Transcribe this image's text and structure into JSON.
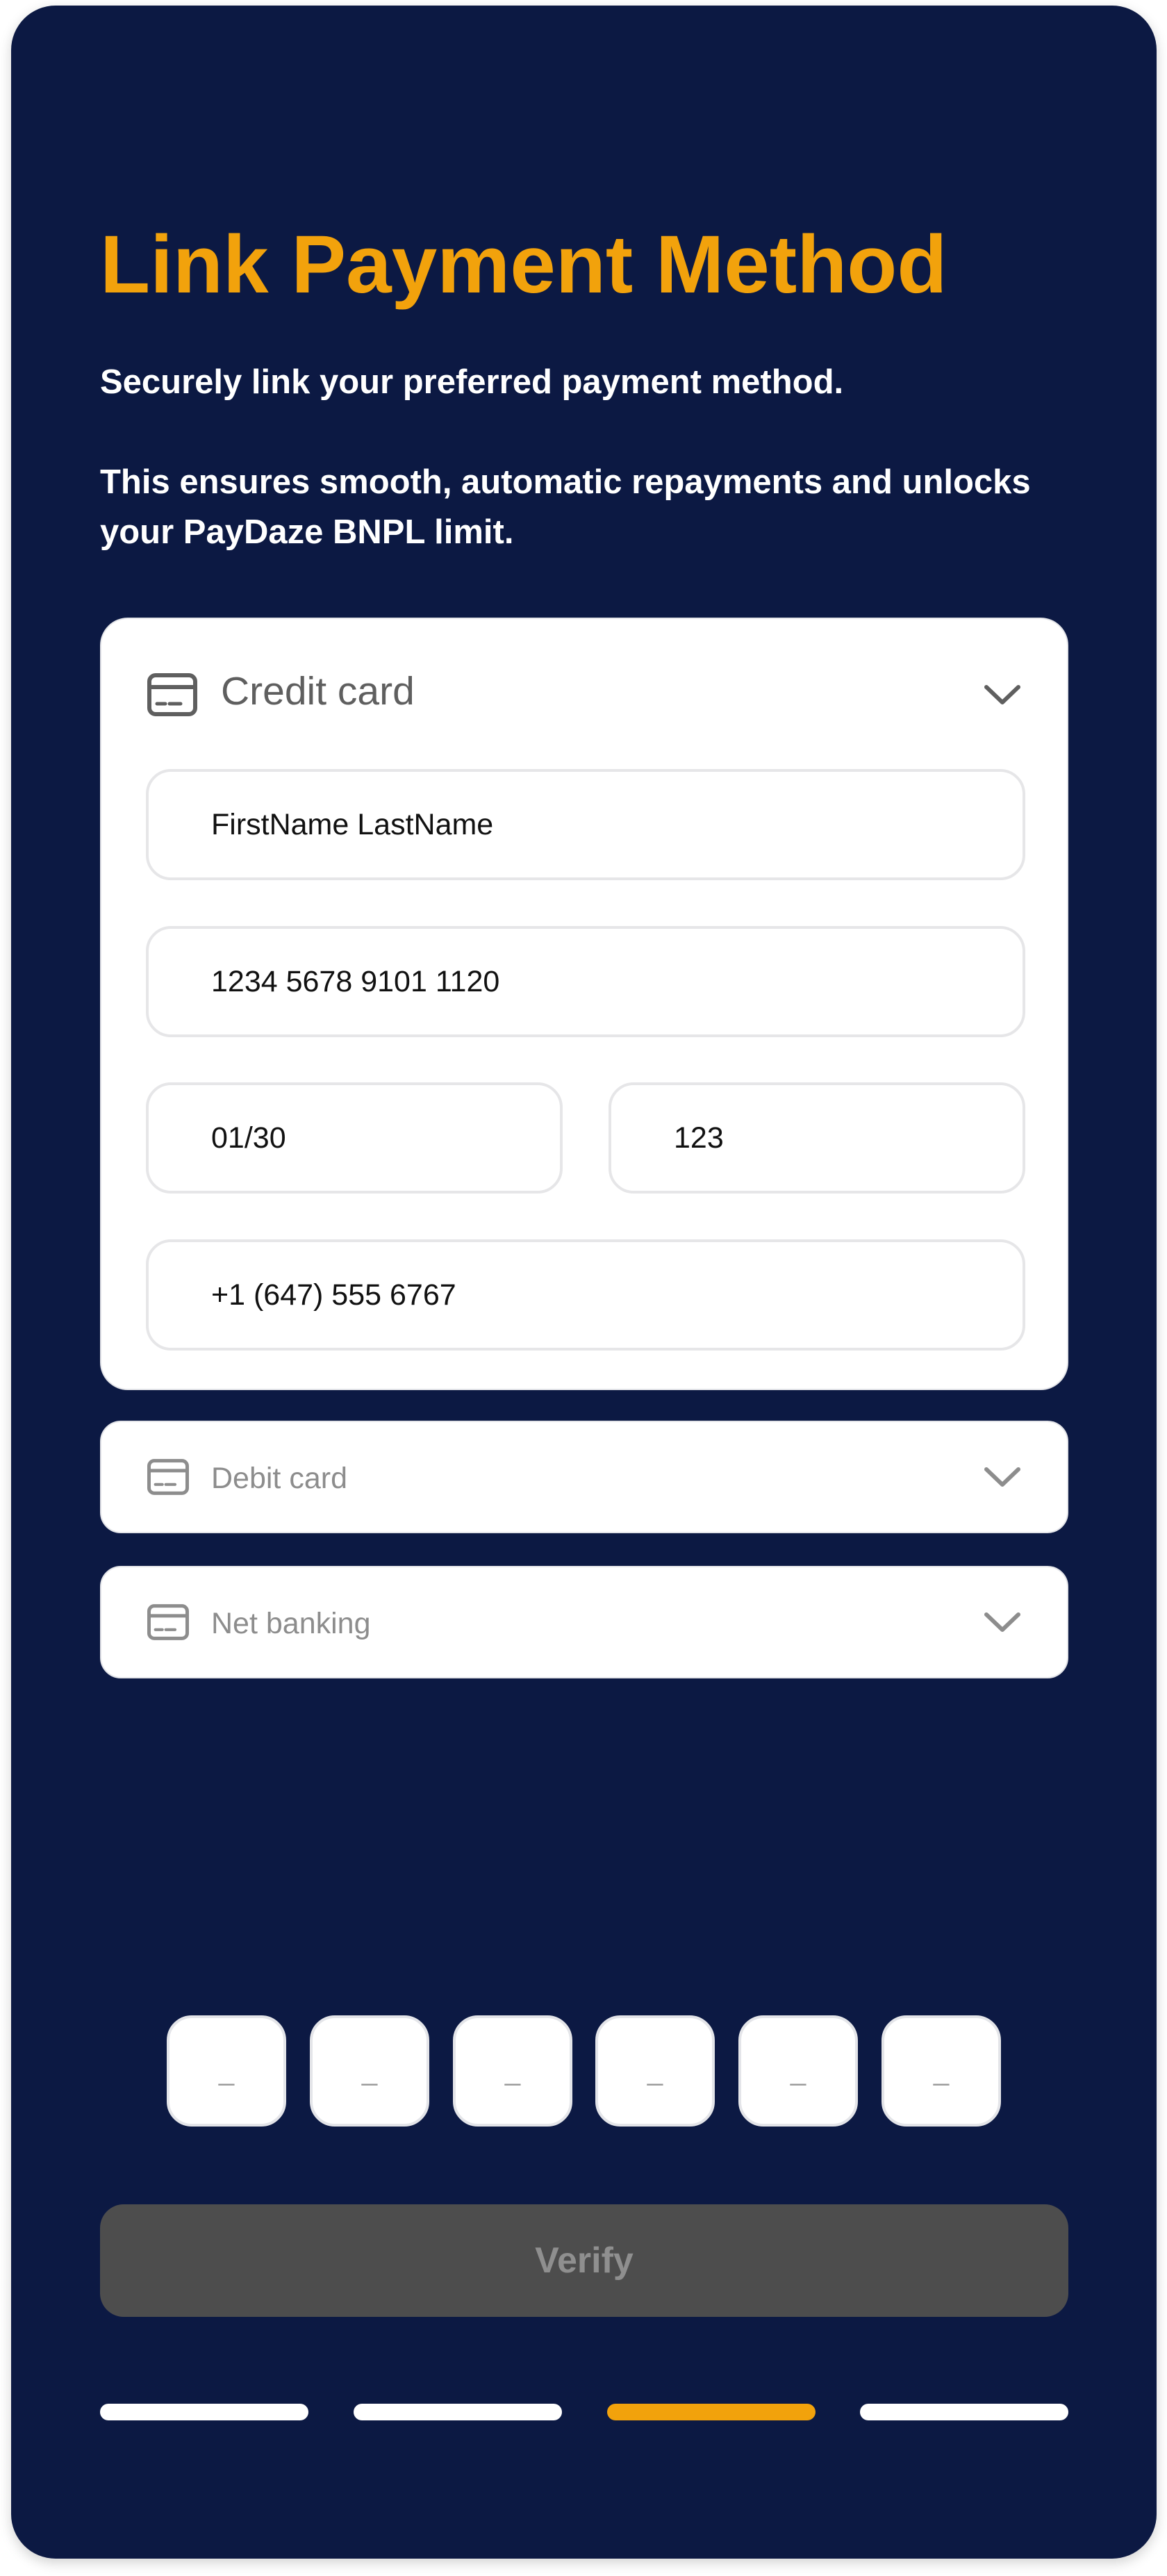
{
  "header": {
    "title": "Link Payment Method",
    "subtitle": "Securely link your preferred payment method.",
    "description": "This ensures smooth, automatic repayments and unlocks your PayDaze BNPL limit."
  },
  "credit_card": {
    "label": "Credit card",
    "icon": "credit-card-icon",
    "expanded": true,
    "name_value": "FirstName LastName",
    "card_number_value": "1234 5678 9101 1120",
    "expiry_value": "01/30",
    "cvv_value": "123",
    "phone_value": "+1 (647) 555 6767"
  },
  "debit_card": {
    "label": "Debit card",
    "icon": "credit-card-icon"
  },
  "net_banking": {
    "label": "Net banking",
    "icon": "credit-card-icon"
  },
  "otp": {
    "digits": [
      "_",
      "_",
      "_",
      "_",
      "_",
      "_"
    ]
  },
  "verify": {
    "label": "Verify",
    "enabled": false
  },
  "progress": {
    "total_steps": 4,
    "current_step": 3
  },
  "colors": {
    "background": "#0c1943",
    "accent": "#f2a20c",
    "button_disabled": "#4d4d4d"
  }
}
